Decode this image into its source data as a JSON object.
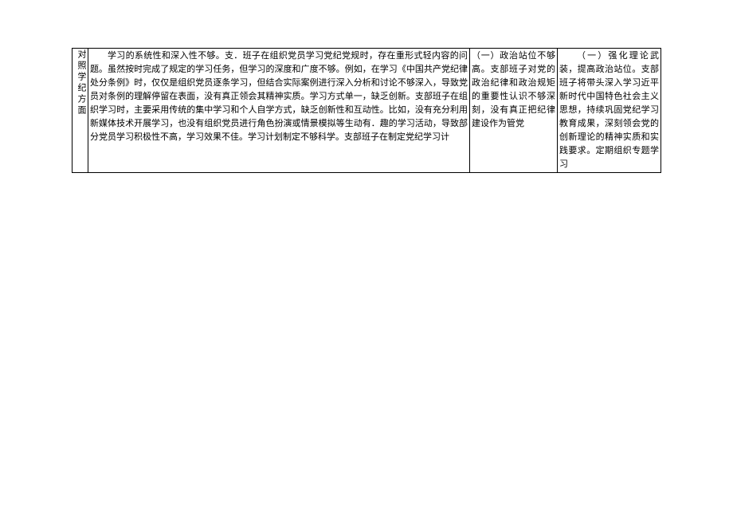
{
  "table": {
    "header_label": "对照学纪方面",
    "col_main": "学习的系统性和深入性不够。支．班子在组织党员学习党纪党规时，存在重形式轻内容的问题。虽然按时完成了规定的学习任务，但学习的深度和广度不够。例如，在学习《中国共产党纪律处分条例》时，仅仅是组织党员逐条学习，但结合实际案例进行深入分析和讨论不够深入，导致党员对条例的理解停留在表面，没有真正领会其精神实质。学习方式单一，缺乏创新。支部班子在组织学习时，主要采用传统的集中学习和个人自学方式，缺乏创新性和互动性。比如，没有充分利用新媒体技术开展学习，也没有组织党员进行角色扮演或情景模拟等生动有．趣的学习活动，导致部分党员学习积极性不高，学习效果不佳。学习计划制定不够科学。支部班子在制定党纪学习计",
    "col_mid": "（一）政治站位不够高。支部班子对党的政治纪律和政治规矩的重要性认识不够深刻，没有真正把纪律建设作为管党",
    "col_right": "（一）强化理论武装，提高政治站位。支部班子将带头深入学习近平新时代中国特色社会主义思想，持续巩固党纪学习教育成果，深刻领会党的创新理论的精神实质和实践要求。定期组织专题学习"
  }
}
